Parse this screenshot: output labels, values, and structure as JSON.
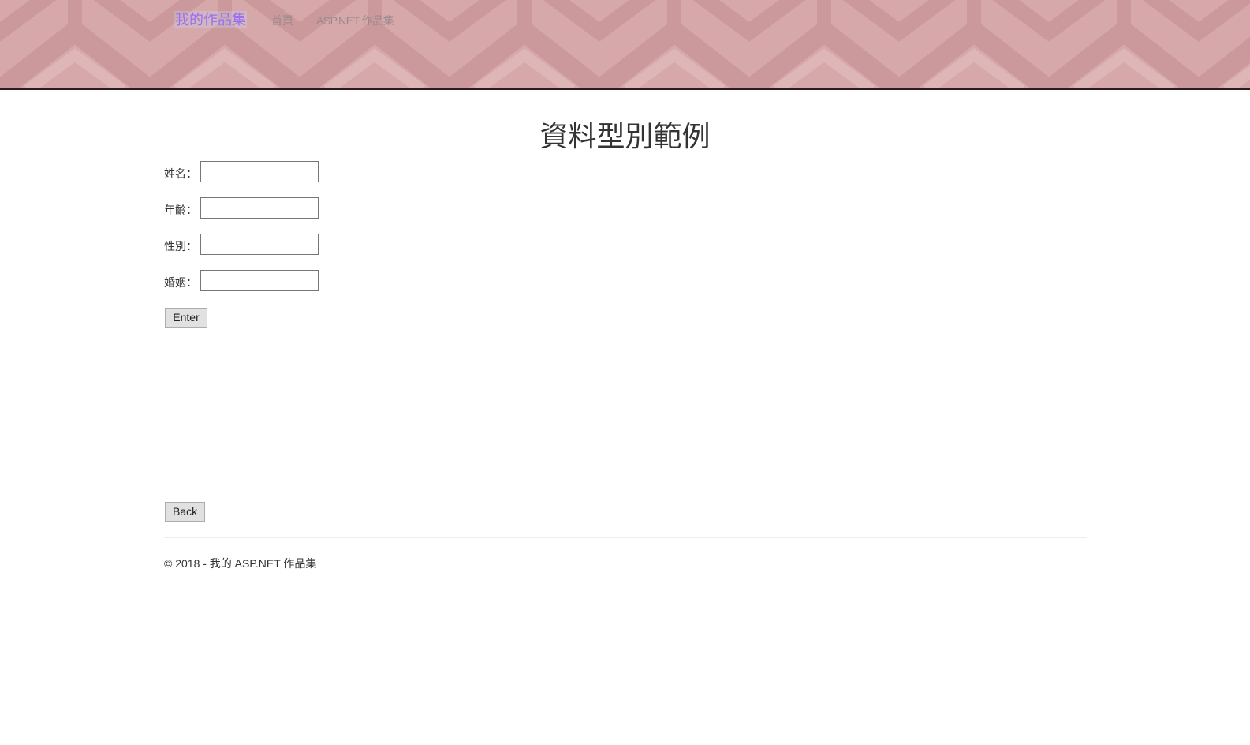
{
  "nav": {
    "brand": "我的作品集",
    "links": [
      "首頁",
      "ASP.NET 作品集"
    ]
  },
  "main": {
    "title": "資料型別範例",
    "fields": [
      {
        "label": "姓名：",
        "value": ""
      },
      {
        "label": "年齡：",
        "value": ""
      },
      {
        "label": "性別：",
        "value": ""
      },
      {
        "label": "婚姻：",
        "value": ""
      }
    ],
    "enter_label": "Enter",
    "back_label": "Back"
  },
  "footer": {
    "text": "© 2018 - 我的 ASP.NET 作品集"
  },
  "colors": {
    "header_bg": "#d7a8aa",
    "brand": "#9b6ff0"
  }
}
